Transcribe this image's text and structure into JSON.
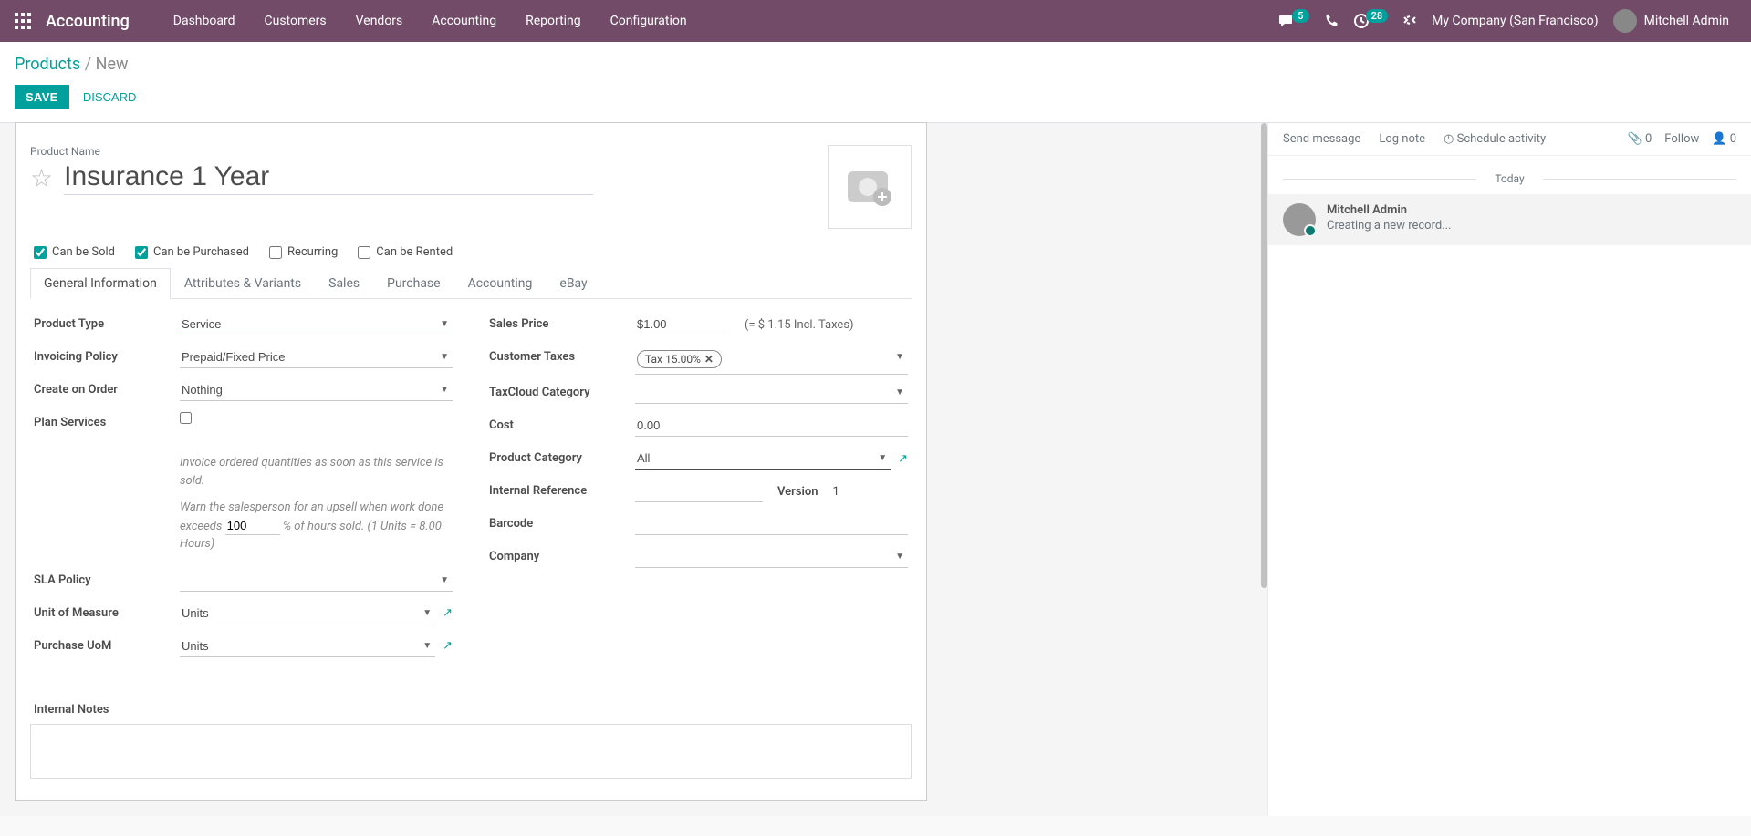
{
  "nav": {
    "brand": "Accounting",
    "menus": [
      "Dashboard",
      "Customers",
      "Vendors",
      "Accounting",
      "Reporting",
      "Configuration"
    ],
    "conv_badge": "5",
    "clock_badge": "28",
    "company": "My Company (San Francisco)",
    "user": "Mitchell Admin"
  },
  "breadcrumb": {
    "parent": "Products",
    "current": "New"
  },
  "actions": {
    "save": "SAVE",
    "discard": "DISCARD"
  },
  "form": {
    "product_name_label": "Product Name",
    "product_name": "Insurance 1 Year",
    "can_be_sold": "Can be Sold",
    "can_be_purchased": "Can be Purchased",
    "recurring": "Recurring",
    "can_be_rented": "Can be Rented",
    "tabs": [
      "General Information",
      "Attributes & Variants",
      "Sales",
      "Purchase",
      "Accounting",
      "eBay"
    ],
    "left": {
      "product_type_label": "Product Type",
      "product_type": "Service",
      "invoicing_policy_label": "Invoicing Policy",
      "invoicing_policy": "Prepaid/Fixed Price",
      "create_on_order_label": "Create on Order",
      "create_on_order": "Nothing",
      "plan_services_label": "Plan Services",
      "help1": "Invoice ordered quantities as soon as this service is sold.",
      "help2a": "Warn the salesperson for an upsell when work done exceeds",
      "help2_val": "100",
      "help2b": "% of hours sold. (1 Units = 8.00 Hours)",
      "sla_label": "SLA Policy",
      "uom_label": "Unit of Measure",
      "uom": "Units",
      "puom_label": "Purchase UoM",
      "puom": "Units"
    },
    "right": {
      "sales_price_label": "Sales Price",
      "sales_price": "$1.00",
      "sales_price_note": "(= $ 1.15 Incl. Taxes)",
      "customer_taxes_label": "Customer Taxes",
      "tax_tag": "Tax 15.00%",
      "taxcloud_label": "TaxCloud Category",
      "cost_label": "Cost",
      "cost": "0.00",
      "category_label": "Product Category",
      "category": "All",
      "internal_ref_label": "Internal Reference",
      "version_label": "Version",
      "version": "1",
      "barcode_label": "Barcode",
      "company_label": "Company"
    },
    "internal_notes_label": "Internal Notes"
  },
  "chatter": {
    "send": "Send message",
    "log": "Log note",
    "schedule": "Schedule activity",
    "attach_count": "0",
    "follow": "Follow",
    "follower_count": "0",
    "today": "Today",
    "msg_author": "Mitchell Admin",
    "msg_body": "Creating a new record..."
  }
}
